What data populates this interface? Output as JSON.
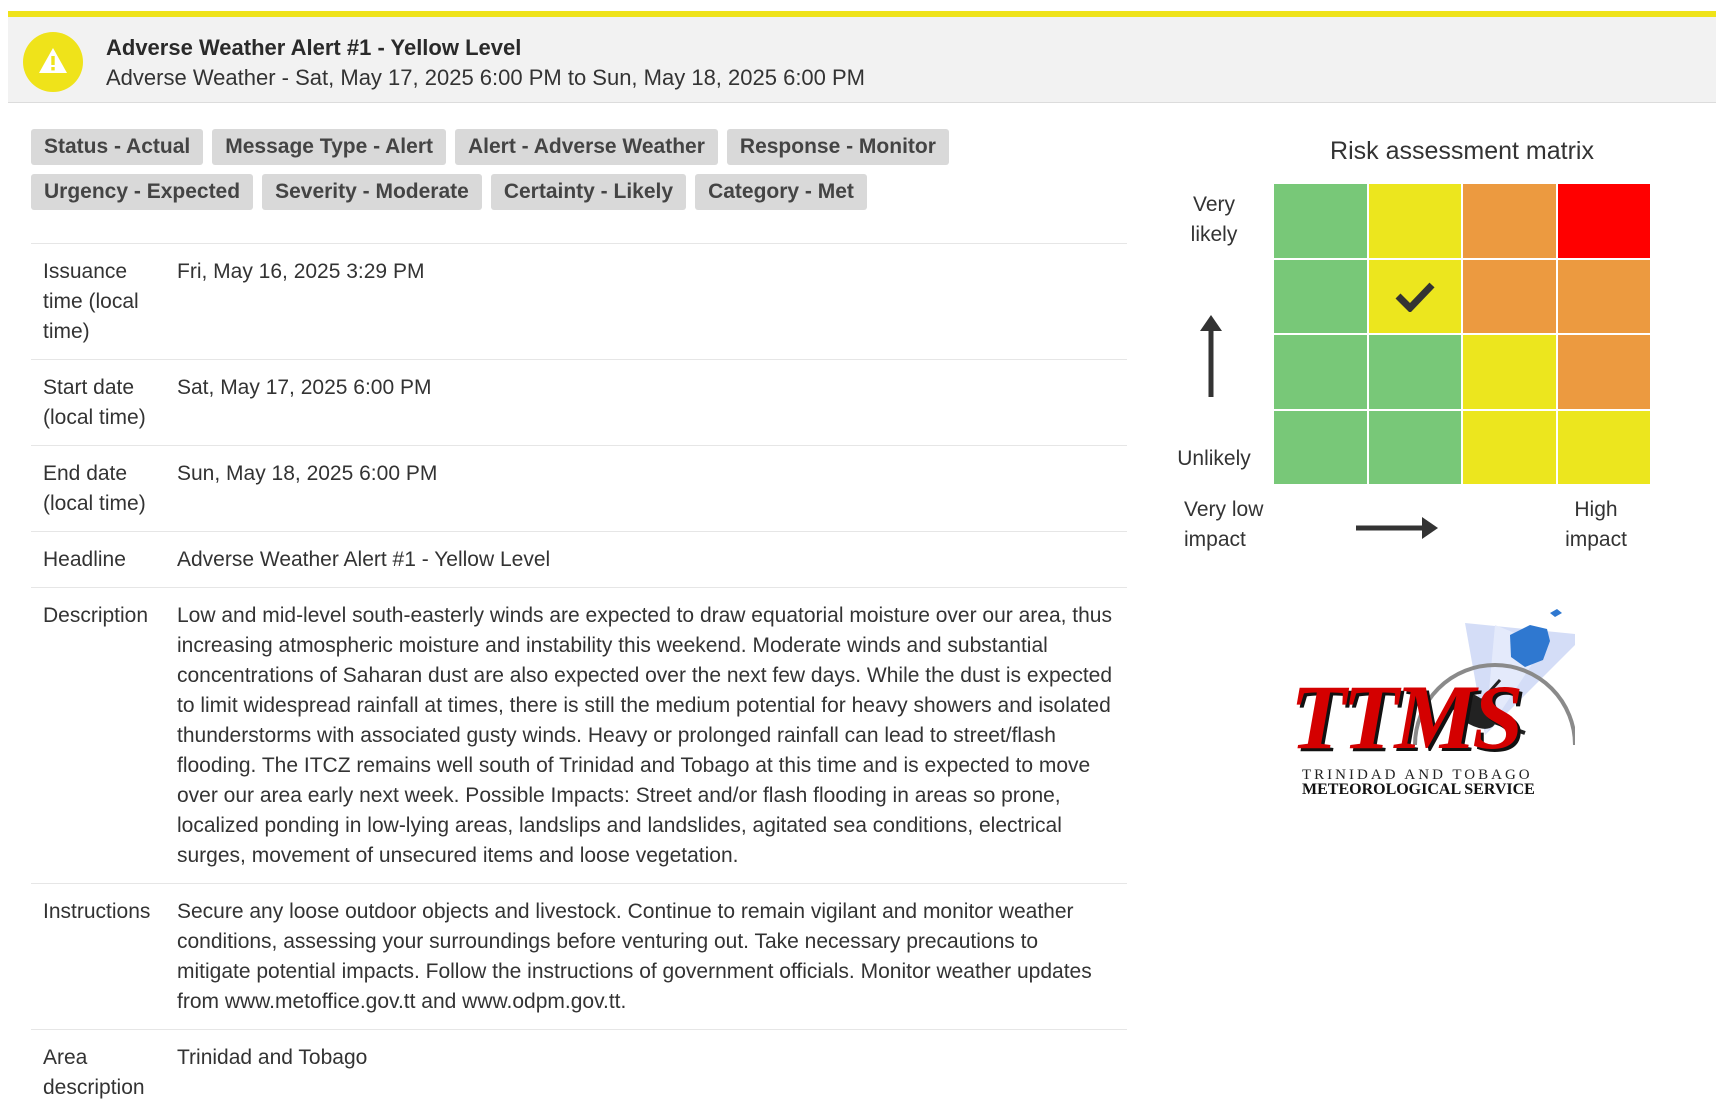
{
  "alert": {
    "title": "Adverse Weather Alert #1 - Yellow Level",
    "subtitle": "Adverse Weather - Sat, May 17, 2025 6:00 PM to Sun, May 18, 2025 6:00 PM",
    "level_color": "#efe31a",
    "icon": "warning-triangle-icon"
  },
  "tags": {
    "row1": [
      "Status - Actual",
      "Message Type - Alert",
      "Alert - Adverse Weather",
      "Response - Monitor"
    ],
    "row2": [
      "Urgency - Expected",
      "Severity - Moderate",
      "Certainty - Likely",
      "Category - Met"
    ]
  },
  "details": [
    {
      "label": "Issuance time (local time)",
      "value": "Fri, May 16, 2025 3:29 PM"
    },
    {
      "label": "Start date (local time)",
      "value": "Sat, May 17, 2025 6:00 PM"
    },
    {
      "label": "End date (local time)",
      "value": "Sun, May 18, 2025 6:00 PM"
    },
    {
      "label": "Headline",
      "value": "Adverse Weather Alert #1 - Yellow Level"
    },
    {
      "label": "Description",
      "value": "Low and mid-level south-easterly winds are expected to draw equatorial moisture over our area, thus increasing atmospheric moisture and instability this weekend. Moderate winds and substantial concentrations of Saharan dust are also expected over the next few days. While the dust is expected to limit widespread rainfall at times, there is still the medium potential for heavy showers and isolated thunderstorms with associated gusty winds. Heavy or prolonged rainfall can lead to street/flash flooding. The ITCZ remains well south of Trinidad and Tobago at this time and is expected to move over our area early next week. Possible Impacts: Street and/or flash flooding in areas so prone, localized ponding in low-lying areas, landslips and landslides, agitated sea conditions, electrical surges, movement of unsecured items and loose vegetation."
    },
    {
      "label": "Instructions",
      "value": "Secure any loose outdoor objects and livestock. Continue to remain vigilant and monitor weather conditions, assessing your surroundings before venturing out. Take necessary precautions to mitigate potential impacts. Follow the instructions of government officials. Monitor weather updates from www.metoffice.gov.tt and www.odpm.gov.tt."
    },
    {
      "label": "Area description",
      "value": "Trinidad and Tobago"
    }
  ],
  "risk_matrix": {
    "title": "Risk assessment matrix",
    "y_top_label": "Very likely",
    "y_bottom_label": "Unlikely",
    "x_left_label": "Very low impact",
    "x_right_label": "High impact",
    "colors": {
      "green": "#78c878",
      "yellow": "#ece61e",
      "orange": "#ec9a40",
      "red": "#ff0000"
    },
    "rows": [
      [
        "green",
        "yellow",
        "orange",
        "red"
      ],
      [
        "green",
        "yellow",
        "orange",
        "orange"
      ],
      [
        "green",
        "green",
        "yellow",
        "orange"
      ],
      [
        "green",
        "green",
        "yellow",
        "yellow"
      ]
    ],
    "selected": {
      "row": 1,
      "col": 1
    }
  },
  "logo": {
    "big": "TTMS",
    "line1": "TRINIDAD AND TOBAGO",
    "line2": "METEOROLOGICAL SERVICE"
  }
}
